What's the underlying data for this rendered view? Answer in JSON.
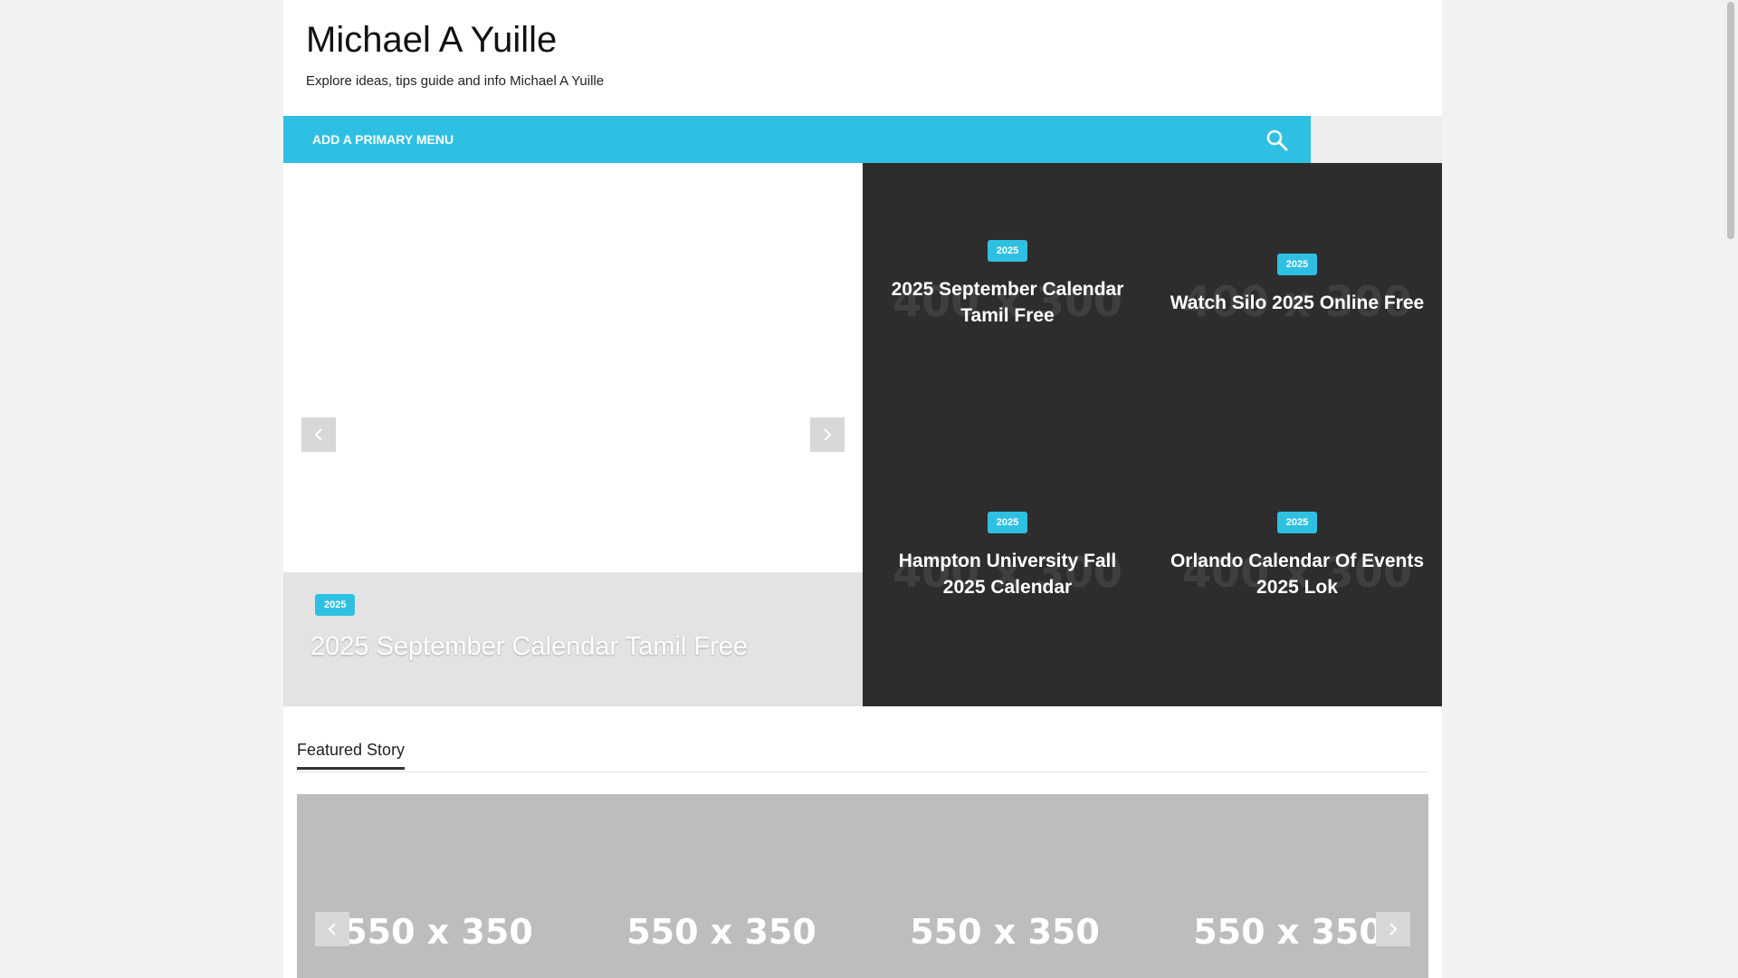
{
  "site": {
    "title": "Michael A Yuille",
    "description": "Explore ideas, tips guide and info Michael A Yuille"
  },
  "nav": {
    "menu_label": "ADD A PRIMARY MENU",
    "search_icon": "search-icon"
  },
  "slider": {
    "category": "2025",
    "title": "2025 September Calendar Tamil Free",
    "prev_icon": "chevron-left-icon",
    "next_icon": "chevron-right-icon"
  },
  "grid": {
    "placeholder": "400 x 300",
    "tiles": [
      {
        "category": "2025",
        "title": "2025 September Calendar Tamil Free"
      },
      {
        "category": "2025",
        "title": "Watch Silo 2025 Online Free"
      },
      {
        "category": "2025",
        "title": "Hampton University Fall 2025 Calendar"
      },
      {
        "category": "2025",
        "title": "Orlando Calendar Of Events 2025 Lok"
      }
    ]
  },
  "featured": {
    "title": "Featured Story",
    "placeholders": [
      "550 x 350",
      "550 x 350",
      "550 x 350",
      "550 x 350"
    ],
    "prev_icon": "chevron-left-icon",
    "next_icon": "chevron-right-icon"
  },
  "colors": {
    "accent": "#2ec0e3",
    "grid_bg": "#2d2d2d",
    "caption_bg": "#e3e3e3",
    "carousel_bg": "#bdbdbd"
  }
}
